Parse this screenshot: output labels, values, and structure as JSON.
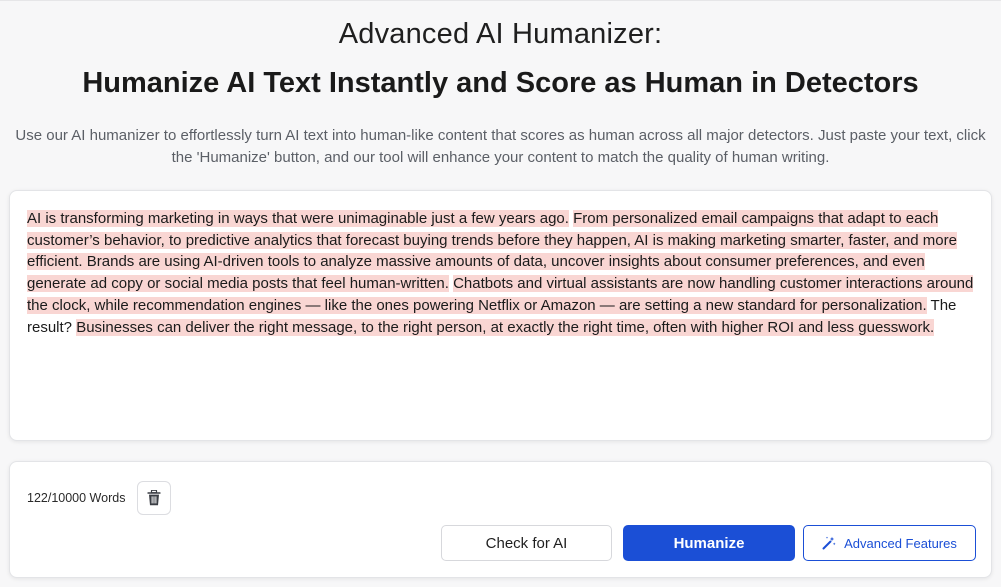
{
  "header": {
    "title_line1": "Advanced AI Humanizer:",
    "title_line2": "Humanize AI Text Instantly and Score as Human in Detectors",
    "description": "Use our AI humanizer to effortlessly turn AI text into human-like content that scores as human across all major detectors. Just paste your text, click the 'Humanize' button, and our tool will enhance your content to match the quality of human writing."
  },
  "editor": {
    "segments": [
      {
        "text": "AI is transforming marketing in ways that were unimaginable just a few years ago.",
        "flagged": true
      },
      {
        "text": " ",
        "flagged": false
      },
      {
        "text": "From personalized email campaigns that adapt to each customer’s behavior, to predictive analytics that forecast buying trends before they happen, AI is making marketing smarter, faster, and more efficient. Brands are using AI-driven tools to analyze massive amounts of data, uncover insights about consumer preferences, and even generate ad copy or social media posts that feel human-written.",
        "flagged": true
      },
      {
        "text": " ",
        "flagged": false
      },
      {
        "text": "Chatbots and virtual assistants are now handling customer interactions around the clock, while recommendation engines — like the ones powering Netflix or Amazon — are setting a new standard for personalization.",
        "flagged": true
      },
      {
        "text": " The result? ",
        "flagged": false
      },
      {
        "text": "Businesses can deliver the right message, to the right person, at exactly the right time, often with higher ROI and less guesswork.",
        "flagged": true
      }
    ]
  },
  "controls": {
    "word_count": "122/10000 Words",
    "trash_icon": "trash-icon",
    "check_label": "Check for AI",
    "humanize_label": "Humanize",
    "advanced_label": "Advanced Features",
    "advanced_icon": "magic-wand-icon"
  },
  "colors": {
    "primary": "#1b4fd6",
    "highlight": "#f9d6d3",
    "background": "#f7f7f8"
  }
}
